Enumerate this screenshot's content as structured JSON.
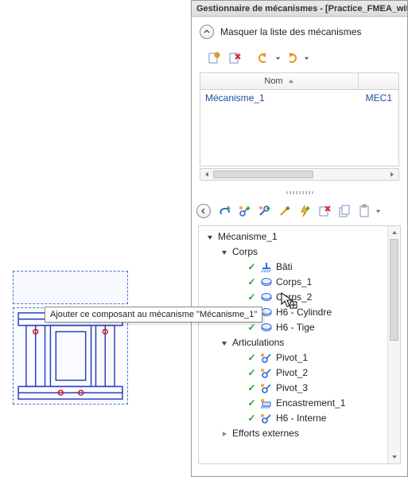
{
  "panel": {
    "title": "Gestionnaire de mécanismes - [Practice_FMEA_wit",
    "masquer_label": "Masquer la liste des mécanismes",
    "list_header_name": "Nom",
    "rows": [
      {
        "name": "Mécanisme_1",
        "code": "MEC1"
      }
    ]
  },
  "toolbar1": {
    "new": "new-mechanism-icon",
    "delete": "delete-mechanism-icon",
    "undo": "undo-icon",
    "redo": "redo-icon"
  },
  "toolbar2": {
    "back": "back-icon",
    "add_body": "add-body-icon",
    "add_joint": "add-joint-icon",
    "edit_joint": "edit-joint-icon",
    "probe": "probe-icon",
    "lightning": "lightning-icon",
    "box_x": "box-x-icon",
    "copy": "copy-icon",
    "clipboard": "clipboard-icon"
  },
  "tree": {
    "root": "Mécanisme_1",
    "bodies_label": "Corps",
    "bodies": [
      {
        "label": "Bâti",
        "icon": "ground-icon"
      },
      {
        "label": "Corps_1",
        "icon": "body-icon"
      },
      {
        "label": "Corps_2",
        "icon": "body-icon"
      },
      {
        "label": "H6 - Cylindre",
        "icon": "body-icon"
      },
      {
        "label": "H6 - Tige",
        "icon": "body-icon"
      }
    ],
    "joints_label": "Articulations",
    "joints": [
      {
        "label": "Pivot_1",
        "icon": "pivot-icon"
      },
      {
        "label": "Pivot_2",
        "icon": "pivot-icon"
      },
      {
        "label": "Pivot_3",
        "icon": "pivot-icon"
      },
      {
        "label": "Encastrement_1",
        "icon": "fixed-icon"
      },
      {
        "label": "H6 - Interne",
        "icon": "pivot-icon"
      }
    ],
    "efforts_label": "Efforts externes"
  },
  "tooltip": "Ajouter ce composant au mécanisme \"Mécanisme_1\""
}
